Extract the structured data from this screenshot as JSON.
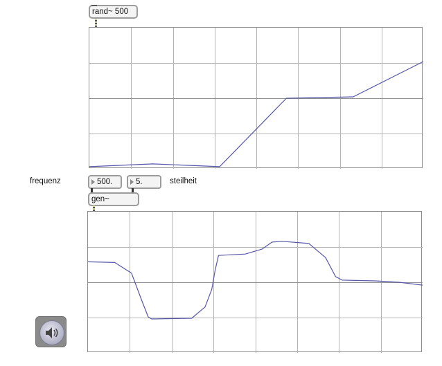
{
  "objects": {
    "rand_label": "rand~ 500",
    "gen_label": "gen~"
  },
  "labels": {
    "frequenz": "frequenz",
    "steilheit": "steilheit"
  },
  "number_boxes": {
    "frequency_value": "500.",
    "steepness_value": "5."
  },
  "scopes": {
    "grid_color": "#b4b4b4",
    "line_color": "#5555aa",
    "rand_scope": {
      "columns": 8,
      "rows": 4,
      "ylim": [
        -1,
        1
      ],
      "samples": [
        [
          0.0,
          -0.97
        ],
        [
          0.19,
          -0.93
        ],
        [
          0.39,
          -0.97
        ],
        [
          0.59,
          -0.0
        ],
        [
          0.79,
          0.02
        ],
        [
          1.0,
          0.52
        ]
      ]
    },
    "gen_scope": {
      "columns": 8,
      "rows": 4,
      "ylim": [
        -1,
        1
      ],
      "samples": [
        [
          0.0,
          0.29
        ],
        [
          0.08,
          0.28
        ],
        [
          0.13,
          0.13
        ],
        [
          0.16,
          -0.25
        ],
        [
          0.18,
          -0.49
        ],
        [
          0.19,
          -0.52
        ],
        [
          0.31,
          -0.51
        ],
        [
          0.35,
          -0.35
        ],
        [
          0.37,
          -0.1
        ],
        [
          0.38,
          0.17
        ],
        [
          0.39,
          0.38
        ],
        [
          0.47,
          0.4
        ],
        [
          0.52,
          0.47
        ],
        [
          0.55,
          0.57
        ],
        [
          0.58,
          0.58
        ],
        [
          0.66,
          0.55
        ],
        [
          0.71,
          0.35
        ],
        [
          0.74,
          0.08
        ],
        [
          0.76,
          0.03
        ],
        [
          0.86,
          0.02
        ],
        [
          0.93,
          -0.0
        ],
        [
          1.0,
          -0.04
        ]
      ]
    }
  },
  "dac": {
    "icon": "speaker-icon",
    "color": "#8a8a8a"
  }
}
